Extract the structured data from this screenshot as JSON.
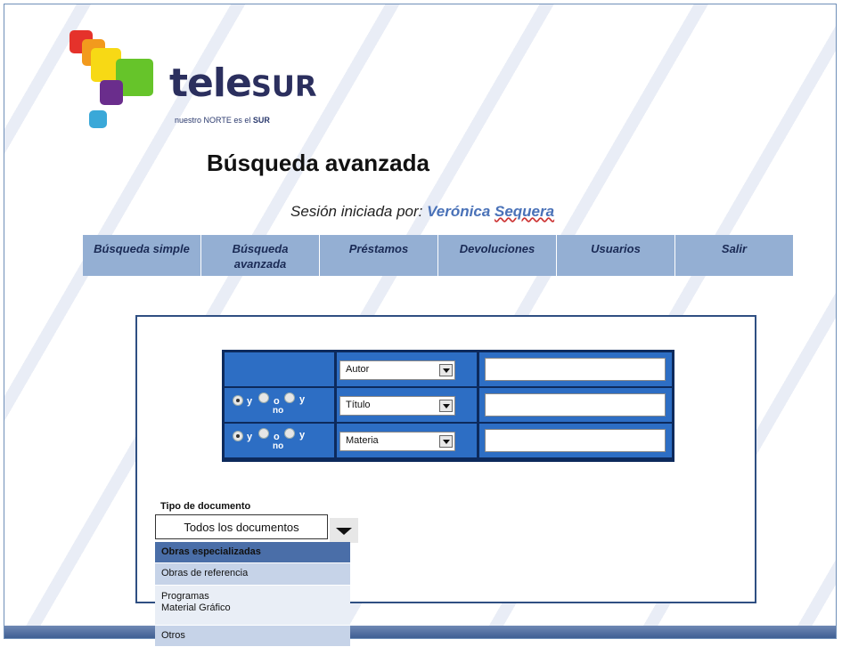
{
  "logo": {
    "word": "tele",
    "word_bold": "SUR",
    "tagline_prefix": "nuestro NORTE es el ",
    "tagline_bold": "SUR"
  },
  "page_title": "Búsqueda avanzada",
  "session": {
    "label": "Sesión iniciada por: ",
    "user_first": "Verónica ",
    "user_last": "Sequera"
  },
  "nav": {
    "items": [
      "Búsqueda simple",
      "Búsqueda\navanzada",
      "Préstamos",
      "Devoluciones",
      "Usuarios",
      "Salir"
    ]
  },
  "criteria": {
    "operators": {
      "and": "y",
      "or": "o",
      "and_not_y": "y",
      "and_not_no": "no"
    },
    "rows": [
      {
        "field": "Autor",
        "value": ""
      },
      {
        "field": "Título",
        "value": ""
      },
      {
        "field": "Materia",
        "value": ""
      }
    ]
  },
  "doc_type": {
    "label": "Tipo de documento",
    "selected": "Todos los documentos",
    "options": [
      "Obras especializadas",
      "Obras de referencia",
      "Programas\nMaterial Gráfico",
      "Otros"
    ]
  },
  "colors": {
    "nav_bg": "#94afd3",
    "criteria_bg": "#2d6ec4",
    "accent": "#4a72b8"
  }
}
